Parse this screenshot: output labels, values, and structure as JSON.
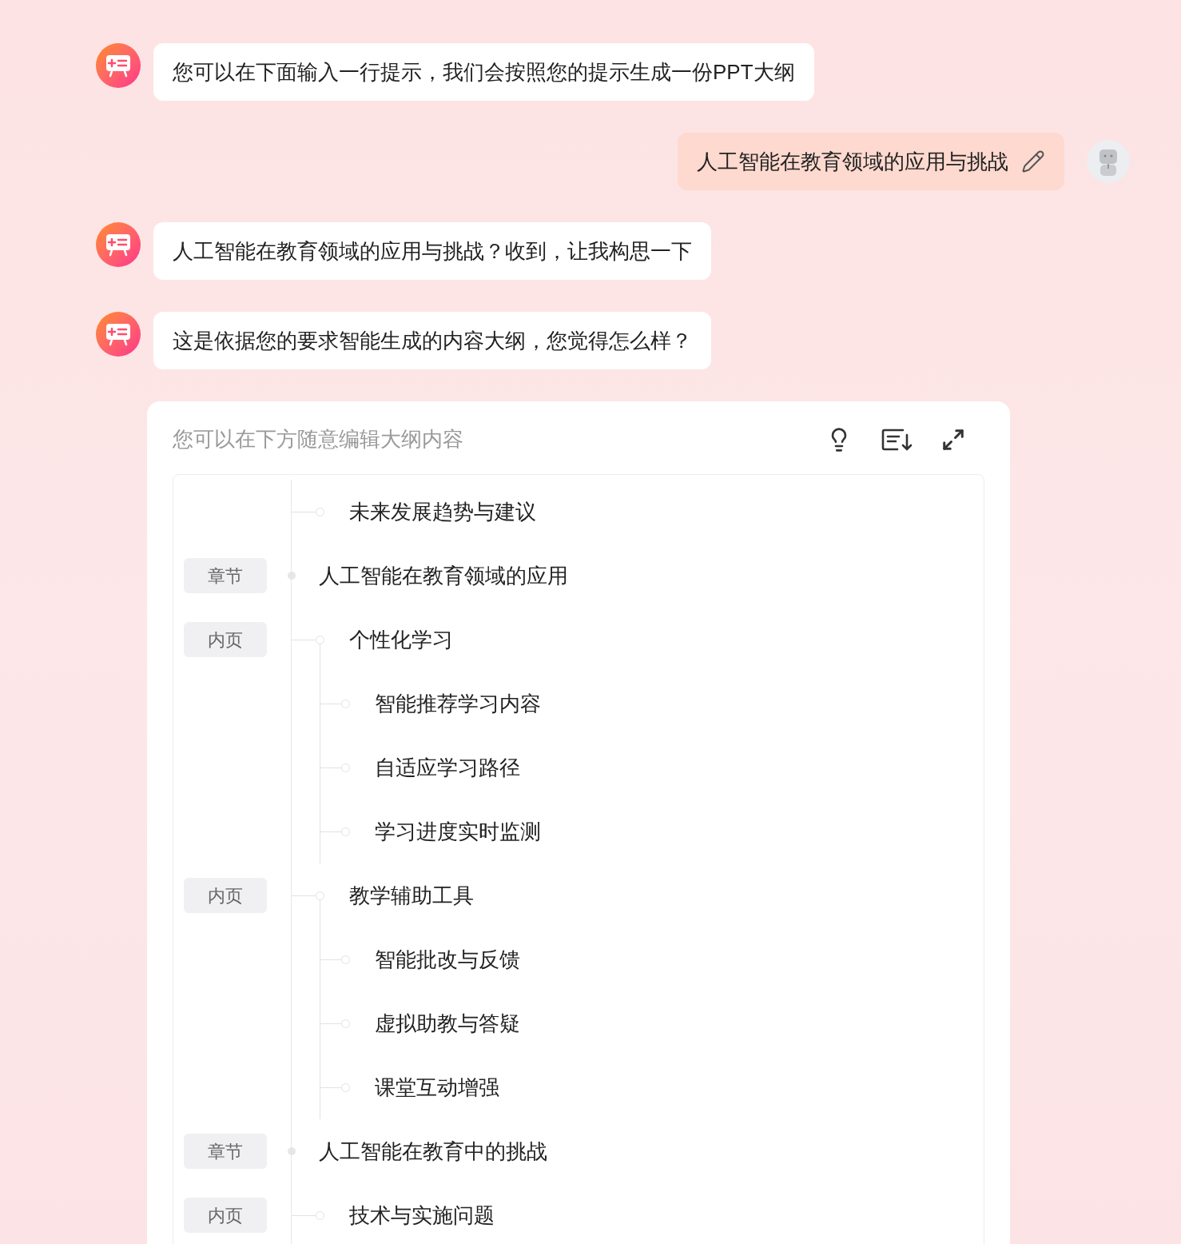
{
  "messages": [
    {
      "kind": "bot",
      "text": "您可以在下面输入一行提示，我们会按照您的提示生成一份PPT大纲"
    },
    {
      "kind": "user",
      "text": "人工智能在教育领域的应用与挑战"
    },
    {
      "kind": "bot",
      "text": "人工智能在教育领域的应用与挑战？收到，让我构思一下"
    },
    {
      "kind": "bot",
      "text": "这是依据您的要求智能生成的内容大纲，您觉得怎么样？"
    }
  ],
  "outline_card": {
    "hint": "您可以在下方随意编辑大纲内容",
    "items": [
      {
        "kind": "page",
        "title": "未来发展趋势与建议"
      },
      {
        "kind": "chapter",
        "tag": "章节",
        "title": "人工智能在教育领域的应用",
        "children": [
          {
            "kind": "page",
            "tag": "内页",
            "title": "个性化学习",
            "children": [
              {
                "kind": "point",
                "title": "智能推荐学习内容"
              },
              {
                "kind": "point",
                "title": "自适应学习路径"
              },
              {
                "kind": "point",
                "title": "学习进度实时监测"
              }
            ]
          },
          {
            "kind": "page",
            "tag": "内页",
            "title": "教学辅助工具",
            "children": [
              {
                "kind": "point",
                "title": "智能批改与反馈"
              },
              {
                "kind": "point",
                "title": "虚拟助教与答疑"
              },
              {
                "kind": "point",
                "title": "课堂互动增强"
              }
            ]
          }
        ]
      },
      {
        "kind": "chapter",
        "tag": "章节",
        "title": "人工智能在教育中的挑战",
        "children": [
          {
            "kind": "page",
            "tag": "内页",
            "title": "技术与实施问题"
          }
        ]
      }
    ]
  }
}
